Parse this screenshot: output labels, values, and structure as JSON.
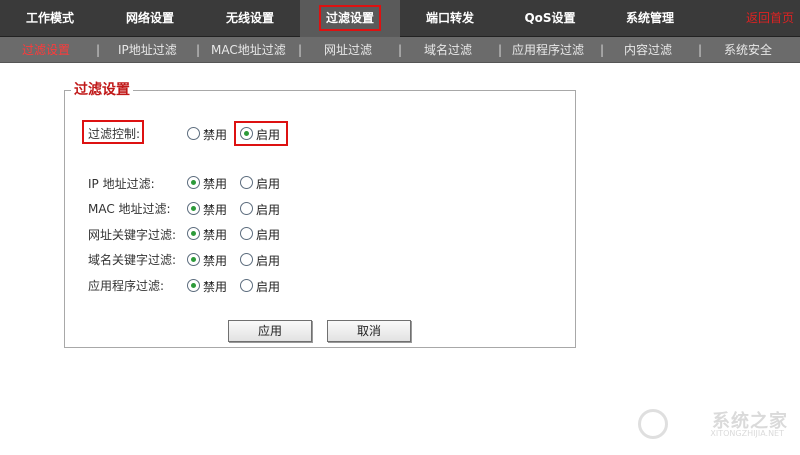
{
  "topnav": {
    "tabs": [
      "工作模式",
      "网络设置",
      "无线设置",
      "过滤设置",
      "端口转发",
      "QoS设置",
      "系统管理"
    ],
    "home": "返回首页"
  },
  "subnav": {
    "items": [
      "过滤设置",
      "IP地址过滤",
      "MAC地址过滤",
      "网址过滤",
      "域名过滤",
      "应用程序过滤",
      "内容过滤",
      "系统安全"
    ]
  },
  "panel": {
    "legend": "过滤设置",
    "master": {
      "label": "过滤控制:",
      "disable": "禁用",
      "enable": "启用",
      "selected": "启用"
    },
    "rows": [
      {
        "label": "IP 地址过滤:",
        "disable": "禁用",
        "enable": "启用",
        "selected": "禁用"
      },
      {
        "label": "MAC 地址过滤:",
        "disable": "禁用",
        "enable": "启用",
        "selected": "禁用"
      },
      {
        "label": "网址关键字过滤:",
        "disable": "禁用",
        "enable": "启用",
        "selected": "禁用"
      },
      {
        "label": "域名关键字过滤:",
        "disable": "禁用",
        "enable": "启用",
        "selected": "禁用"
      },
      {
        "label": "应用程序过滤:",
        "disable": "禁用",
        "enable": "启用",
        "selected": "禁用"
      }
    ],
    "apply_label": "应用",
    "cancel_label": "取消"
  },
  "watermark": {
    "text": "系统之家",
    "url": "XITONGZHIJIA.NET"
  }
}
